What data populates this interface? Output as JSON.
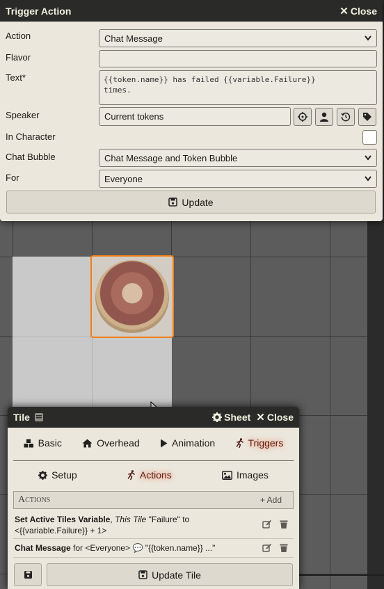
{
  "trigger_window": {
    "title": "Trigger Action",
    "close_label": "Close",
    "fields": {
      "action": {
        "label": "Action",
        "value": "Chat Message"
      },
      "flavor": {
        "label": "Flavor",
        "value": ""
      },
      "text": {
        "label": "Text*",
        "value": "{{token.name}} has failed {{variable.Failure}}\ntimes."
      },
      "speaker": {
        "label": "Speaker",
        "value": "Current tokens"
      },
      "in_character": {
        "label": "In Character",
        "checked": false
      },
      "chat_bubble": {
        "label": "Chat Bubble",
        "value": "Chat Message and Token Bubble"
      },
      "for": {
        "label": "For",
        "value": "Everyone"
      }
    },
    "update_label": "Update"
  },
  "tile_window": {
    "title": "Tile",
    "sheet_label": "Sheet",
    "close_label": "Close",
    "tabs": [
      {
        "label": "Basic",
        "icon": "cubes-icon"
      },
      {
        "label": "Overhead",
        "icon": "home-icon"
      },
      {
        "label": "Animation",
        "icon": "play-icon"
      },
      {
        "label": "Triggers",
        "icon": "running-icon",
        "active": true
      }
    ],
    "subtabs": [
      {
        "label": "Setup",
        "icon": "cog-icon"
      },
      {
        "label": "Actions",
        "icon": "running-icon",
        "active": true
      },
      {
        "label": "Images",
        "icon": "image-icon"
      }
    ],
    "actions_header": "Actions",
    "add_label": "Add",
    "actions": [
      {
        "title": "Set Active Tiles Variable",
        "entity": "This Tile",
        "detail": "\"Failure\" to",
        "detail2": "<{{variable.Failure}} + 1>"
      },
      {
        "title": "Chat Message",
        "for_text": "for <Everyone>",
        "detail": "\"{{token.name}} ...\""
      }
    ],
    "update_tile_label": "Update Tile"
  },
  "colors": {
    "header": "#2a2a28",
    "panel": "#ebe7dd",
    "active_tab": "#58201a",
    "token_border": "#f07f19"
  }
}
